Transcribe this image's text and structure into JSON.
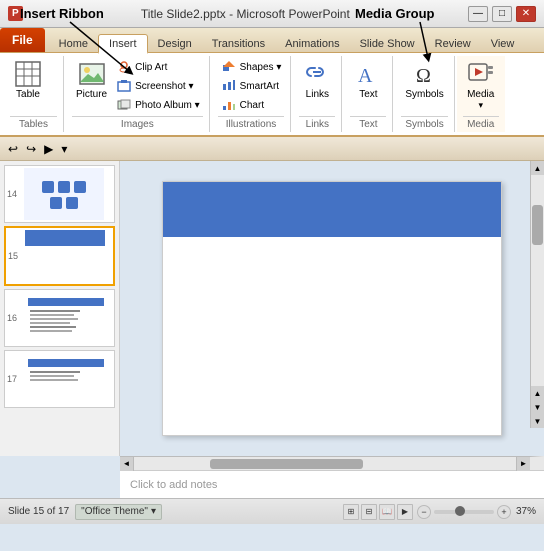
{
  "annotations": {
    "insert_ribbon": "Insert Ribbon",
    "media_group": "Media Group"
  },
  "title_bar": {
    "logo": "P",
    "title": "Title Slide2.pptx - Microsoft PowerPoint",
    "min": "—",
    "max": "□",
    "close": "✕"
  },
  "ribbon_tabs": {
    "file": "File",
    "tabs": [
      "Home",
      "Insert",
      "Design",
      "Transitions",
      "Animations",
      "Slide Show",
      "Review",
      "View"
    ]
  },
  "ribbon_groups": {
    "tables": {
      "label": "Tables",
      "items": [
        {
          "name": "Table",
          "icon": "⊞"
        }
      ]
    },
    "images": {
      "label": "Images",
      "items": [
        "Picture",
        "Clip Art",
        "Screenshot",
        "Photo Album"
      ]
    },
    "illustrations": {
      "label": "Illustrations",
      "items": [
        "Shapes",
        "SmartArt",
        "Chart"
      ]
    },
    "links": {
      "label": "Links",
      "items": [
        {
          "name": "Links",
          "icon": "🔗"
        }
      ]
    },
    "text": {
      "label": "Text",
      "items": [
        {
          "name": "Text",
          "icon": "A"
        }
      ]
    },
    "symbols": {
      "label": "Symbols",
      "items": [
        {
          "name": "Symbols",
          "icon": "Ω"
        }
      ]
    },
    "media": {
      "label": "Media",
      "items": [
        {
          "name": "Media",
          "icon": "▶"
        }
      ]
    }
  },
  "quick_access": {
    "undo": "↩",
    "redo": "↪",
    "start": "▶"
  },
  "slides": [
    {
      "num": "14",
      "active": false
    },
    {
      "num": "15",
      "active": true
    },
    {
      "num": "16",
      "active": false
    },
    {
      "num": "17",
      "active": false
    }
  ],
  "status_bar": {
    "slide_info": "Slide 15 of 17",
    "theme": "\"Office Theme\"",
    "zoom": "37%"
  },
  "notes": {
    "placeholder": "Click to add notes"
  }
}
